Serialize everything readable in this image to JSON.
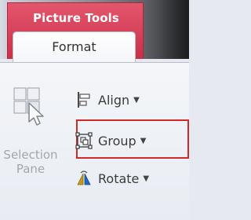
{
  "context_tab": {
    "label": "Picture Tools"
  },
  "tab": {
    "label": "Format"
  },
  "selection_pane": {
    "line1": "Selection",
    "line2": "Pane",
    "icon": "selection-pane-icon"
  },
  "commands": {
    "align": {
      "label": "Align",
      "icon": "align-icon"
    },
    "group": {
      "label": "Group",
      "icon": "group-icon"
    },
    "rotate": {
      "label": "Rotate",
      "icon": "rotate-icon"
    }
  },
  "dropdown_glyph": "▼",
  "colors": {
    "context_tab": "#d63e55",
    "highlight": "#d02a2a"
  }
}
